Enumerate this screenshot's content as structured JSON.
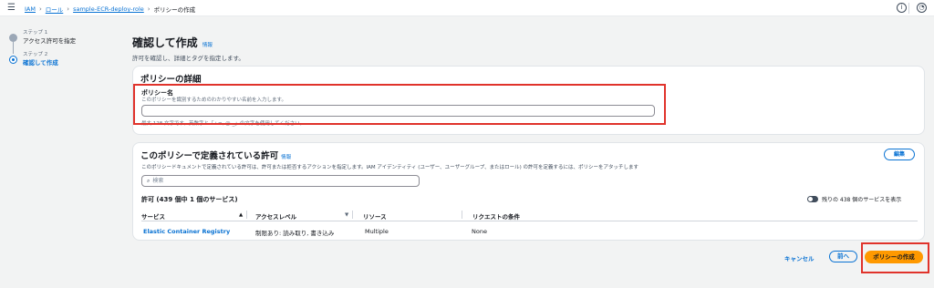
{
  "topbar": {
    "menu_icon": "hamburger-icon",
    "breadcrumbs": [
      "IAM",
      "ロール",
      "sample-ECR-deploy-role",
      "ポリシーの作成"
    ],
    "icons": [
      "info-circle-icon",
      "settings-icon"
    ]
  },
  "steps": [
    {
      "number": "ステップ 1",
      "title": "アクセス許可を指定"
    },
    {
      "number": "ステップ 2",
      "title": "確認して作成"
    }
  ],
  "header": {
    "title": "確認して作成",
    "info": "情報",
    "description": "許可を確認し、詳細とタグを指定します。"
  },
  "policy_details": {
    "title": "ポリシーの詳細",
    "name_label": "ポリシー名",
    "name_description": "このポリシーを識別するためのわかりやすい名前を入力します。",
    "name_value": "",
    "name_hint": "最大 128 文字です。英数字と「+=,.@-_」の文字を使用してください。"
  },
  "permissions": {
    "title": "このポリシーで定義されている許可",
    "info": "情報",
    "edit_label": "編集",
    "description": "このポリシードキュメントで定義されている許可は、許可または拒否するアクションを指定します。IAM アイデンティティ (ユーザー、ユーザーグループ、またはロール) の許可を定義するには、ポリシーをアタッチします",
    "search_placeholder": "検索",
    "summary": "許可 (439 個中 1 個のサービス)",
    "toggle_label": "残りの 438 個のサービスを表示",
    "columns": [
      "サービス",
      "アクセスレベル",
      "リソース",
      "リクエストの条件"
    ],
    "rows": [
      {
        "service": "Elastic Container Registry",
        "access": "制限あり: 読み取り, 書き込み",
        "resource": "Multiple",
        "condition": "None"
      }
    ]
  },
  "footer": {
    "cancel": "キャンセル",
    "prev": "前へ",
    "create": "ポリシーの作成"
  },
  "colors": {
    "accent": "#0972d3",
    "primary_button": "#ff9900",
    "highlight": "#e0332b"
  }
}
